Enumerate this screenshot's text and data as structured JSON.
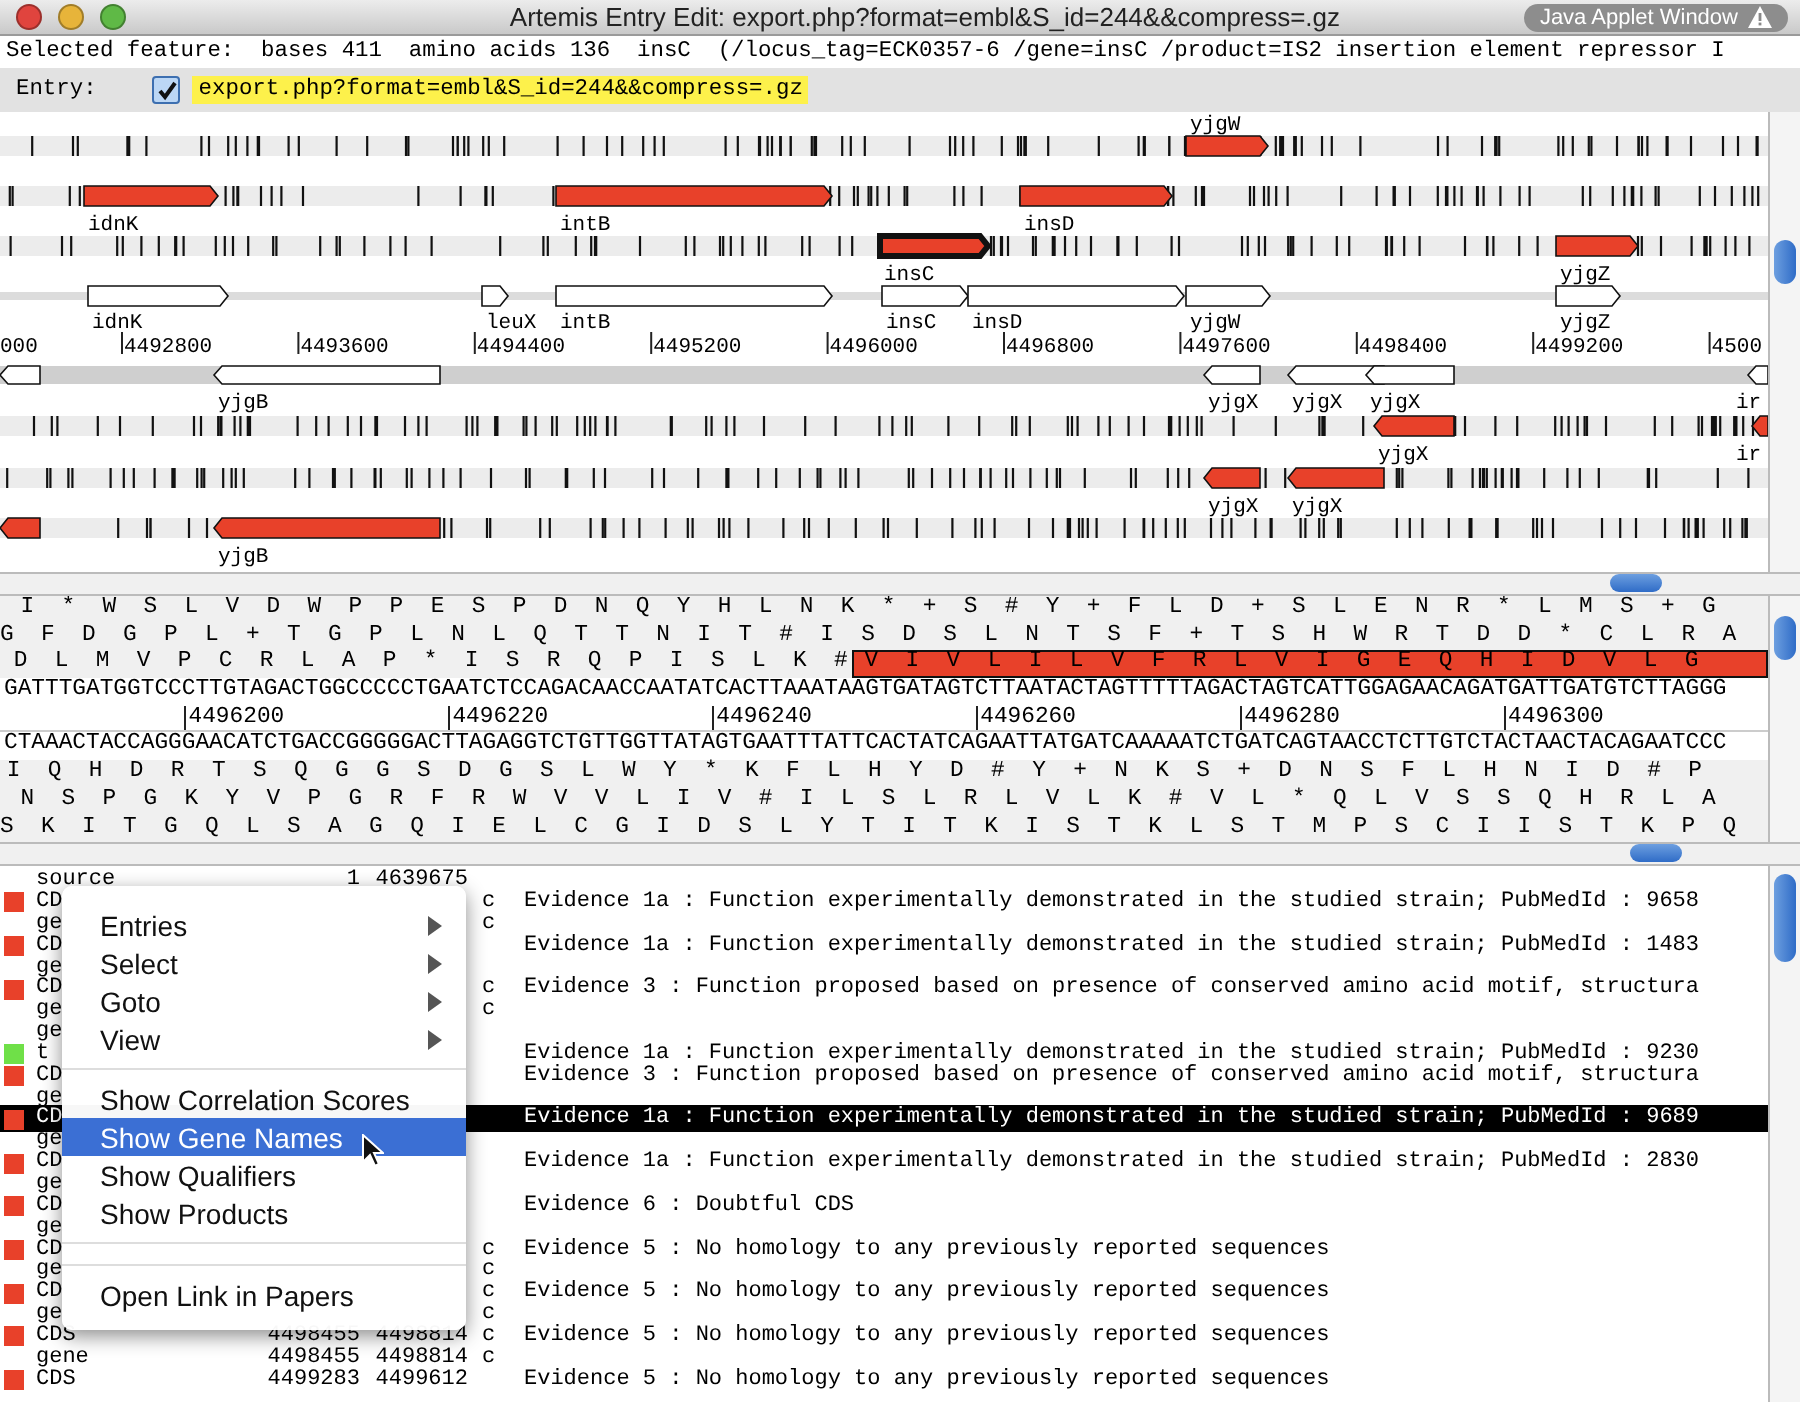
{
  "window": {
    "title": "Artemis Entry Edit: export.php?format=embl&S_id=244&&compress=.gz",
    "badge": "Java Applet Window"
  },
  "selected_feature": "Selected feature:  bases 411  amino acids 136  insC  (/locus_tag=ECK0357-6 /gene=insC /product=IS2 insertion element repressor I",
  "entry": {
    "label": "Entry:",
    "name": "export.php?format=embl&S_id=244&&compress=.gz",
    "checked": true
  },
  "feature_view": {
    "features": [
      {
        "kind": "frame",
        "label": "yjgW",
        "selected": false
      },
      {
        "kind": "frame",
        "label": "idnK",
        "selected": false
      },
      {
        "kind": "frame",
        "label": "intB",
        "selected": false
      },
      {
        "kind": "frame",
        "label": "insD",
        "selected": false
      },
      {
        "kind": "frame",
        "label": "insC",
        "selected": true
      },
      {
        "kind": "frame",
        "label": "yjgZ",
        "selected": false
      },
      {
        "kind": "gene",
        "label": "idnK",
        "selected": false
      },
      {
        "kind": "gene",
        "label": "leuX",
        "selected": false
      },
      {
        "kind": "gene",
        "label": "intB",
        "selected": false
      },
      {
        "kind": "gene",
        "label": "insC",
        "selected": false
      },
      {
        "kind": "gene",
        "label": "insD",
        "selected": false
      },
      {
        "kind": "gene",
        "label": "yjgW",
        "selected": false
      },
      {
        "kind": "gene",
        "label": "yjgZ",
        "selected": false
      },
      {
        "kind": "gene",
        "selected": false
      },
      {
        "kind": "gene",
        "label": "yjgB",
        "selected": false
      },
      {
        "kind": "gene",
        "label": "yjgX",
        "selected": false
      },
      {
        "kind": "gene",
        "label": "yjgX",
        "selected": false
      },
      {
        "kind": "gene",
        "label": "yjgX",
        "selected": false
      },
      {
        "kind": "gene",
        "label": "ir",
        "selected": false
      },
      {
        "kind": "frame",
        "label": "yjgX",
        "selected": false
      },
      {
        "kind": "frame",
        "label": "ir",
        "selected": false
      },
      {
        "kind": "frame",
        "label": "yjgX",
        "selected": false
      },
      {
        "kind": "frame",
        "label": "yjgX",
        "selected": false
      },
      {
        "kind": "frame",
        "selected": false
      },
      {
        "kind": "frame",
        "label": "yjgB",
        "selected": false
      }
    ],
    "scale": [
      "000",
      "4492800",
      "4493600",
      "4494400",
      "4495200",
      "4496000",
      "4496800",
      "4497600",
      "4498400",
      "4499200",
      "4500"
    ]
  },
  "sequence_view": {
    "forward_frames": [
      [
        {
          "text": "I * W S L V D W P P E S P D N Q Y H L N K * + S # Y + F L D + S L E N R * L M S + G",
          "selected": false
        }
      ],
      [
        {
          "text": "G F D G P L + T G P L N L Q T T N I T # I S D S L N T S F + T S H W R T D D * C L R A",
          "selected": false
        }
      ],
      [
        {
          "text": "D L M V P C R L A P * I S R Q P I S L K #",
          "selected": false
        },
        {
          "text": "V I V L I L V F R L V I G E Q H I D V L G",
          "selected": true
        }
      ]
    ],
    "forward_dna": "GATTTGATGGTCCCTTGTAGACTGGCCCCCTGAATCTCCAGACAACCAATATCACTTAAATAAGTGATAGTCTTAATACTAGTTTTTAGACTAGTCATTGGAGAACAGATGATTGATGTCTTAGGG",
    "scale": [
      "4496200",
      "4496220",
      "4496240",
      "4496260",
      "4496280",
      "4496300"
    ],
    "reverse_dna": "CTAAACTACCAGGGAACATCTGACCGGGGGACTTAGAGGTCTGTTGGTTATAGTGAATTTATTCACTATCAGAATTATGATCAAAAATCTGATCAGTAACCTCTTGTCTACTAACTACAGAATCCC",
    "reverse_frames": [
      [
        {
          "text": "I Q H D R T S Q G G S D G S L W Y * K F L H Y D # Y + N K S + D N S F L H N I D # P",
          "selected": false
        }
      ],
      [
        {
          "text": "N S P G K Y V P G R F R W V V L I V # I L S L R L V L K # V L * Q L V S S Q H R L A",
          "selected": false
        }
      ],
      [
        {
          "text": "S K I T G Q L S A G Q I E L C G I D S L Y T I T K I S T K L S T M P S C I I S T K P Q",
          "selected": false
        }
      ]
    ]
  },
  "feature_list": {
    "rows": [
      {
        "key": "source",
        "start": "1",
        "end": "4639675",
        "selected": false
      },
      {
        "key": "CD",
        "color": "#e8412a",
        "strand": "c",
        "qualifier": "Evidence 1a : Function experimentally demonstrated in the studied strain; PubMedId : 9658",
        "selected": false
      },
      {
        "key": "ge",
        "strand": "c",
        "selected": false
      },
      {
        "key": "CD",
        "color": "#e8412a",
        "qualifier": "Evidence 1a : Function experimentally demonstrated in the studied strain; PubMedId : 1483",
        "selected": false
      },
      {
        "key": "ge",
        "selected": false
      },
      {
        "key": "CD",
        "color": "#e8412a",
        "strand": "c",
        "qualifier": "Evidence 3 : Function proposed based on presence of conserved amino acid motif, structura",
        "selected": false
      },
      {
        "key": "ge",
        "strand": "c",
        "selected": false
      },
      {
        "key": "ge",
        "selected": false
      },
      {
        "key": "t",
        "color": "#6fe048",
        "qualifier": "Evidence 1a : Function experimentally demonstrated in the studied strain; PubMedId : 9230",
        "selected": false
      },
      {
        "key": "CD",
        "color": "#e8412a",
        "qualifier": "Evidence 3 : Function proposed based on presence of conserved amino acid motif, structura",
        "selected": false
      },
      {
        "key": "ge",
        "selected": false
      },
      {
        "key": "CD",
        "color": "#e8412a",
        "qualifier": "Evidence 1a : Function experimentally demonstrated in the studied strain; PubMedId : 9689",
        "selected": true
      },
      {
        "key": "ge",
        "selected": false
      },
      {
        "key": "CD",
        "color": "#e8412a",
        "qualifier": "Evidence 1a : Function experimentally demonstrated in the studied strain; PubMedId : 2830",
        "selected": false
      },
      {
        "key": "ge",
        "selected": false
      },
      {
        "key": "CD",
        "color": "#e8412a",
        "qualifier": "Evidence 6 : Doubtful CDS",
        "selected": false
      },
      {
        "key": "ge",
        "selected": false
      },
      {
        "key": "CD",
        "color": "#e8412a",
        "strand": "c",
        "qualifier": "Evidence 5 : No homology to any previously reported sequences",
        "selected": false
      },
      {
        "key": "ge",
        "strand": "c",
        "selected": false
      },
      {
        "key": "CD",
        "color": "#e8412a",
        "strand": "c",
        "qualifier": "Evidence 5 : No homology to any previously reported sequences",
        "selected": false
      },
      {
        "key": "ge",
        "strand": "c",
        "selected": false
      },
      {
        "key": "CDS",
        "color": "#e8412a",
        "start": "4498455",
        "end": "4498814",
        "strand": "c",
        "qualifier": "Evidence 5 : No homology to any previously reported sequences",
        "selected": false
      },
      {
        "key": "gene",
        "start": "4498455",
        "end": "4498814",
        "strand": "c",
        "selected": false
      },
      {
        "key": "CDS",
        "color": "#e8412a",
        "start": "4499283",
        "end": "4499612",
        "qualifier": "Evidence 5 : No homology to any previously reported sequences",
        "selected": false
      }
    ]
  },
  "context_menu": {
    "items": [
      {
        "kind": "submenu",
        "label": "Entries",
        "selected": false
      },
      {
        "kind": "submenu",
        "label": "Select",
        "selected": false
      },
      {
        "kind": "submenu",
        "label": "Goto",
        "selected": false
      },
      {
        "kind": "submenu",
        "label": "View",
        "selected": false
      },
      {
        "kind": "separator"
      },
      {
        "kind": "item",
        "label": "Show Correlation Scores",
        "selected": false
      },
      {
        "kind": "item",
        "label": "Show Gene Names",
        "selected": true
      },
      {
        "kind": "item",
        "label": "Show Qualifiers",
        "selected": false
      },
      {
        "kind": "item",
        "label": "Show Products",
        "selected": false
      },
      {
        "kind": "separator"
      },
      {
        "kind": "separator"
      },
      {
        "kind": "item",
        "label": "Open Link in Papers",
        "selected": false
      }
    ]
  }
}
